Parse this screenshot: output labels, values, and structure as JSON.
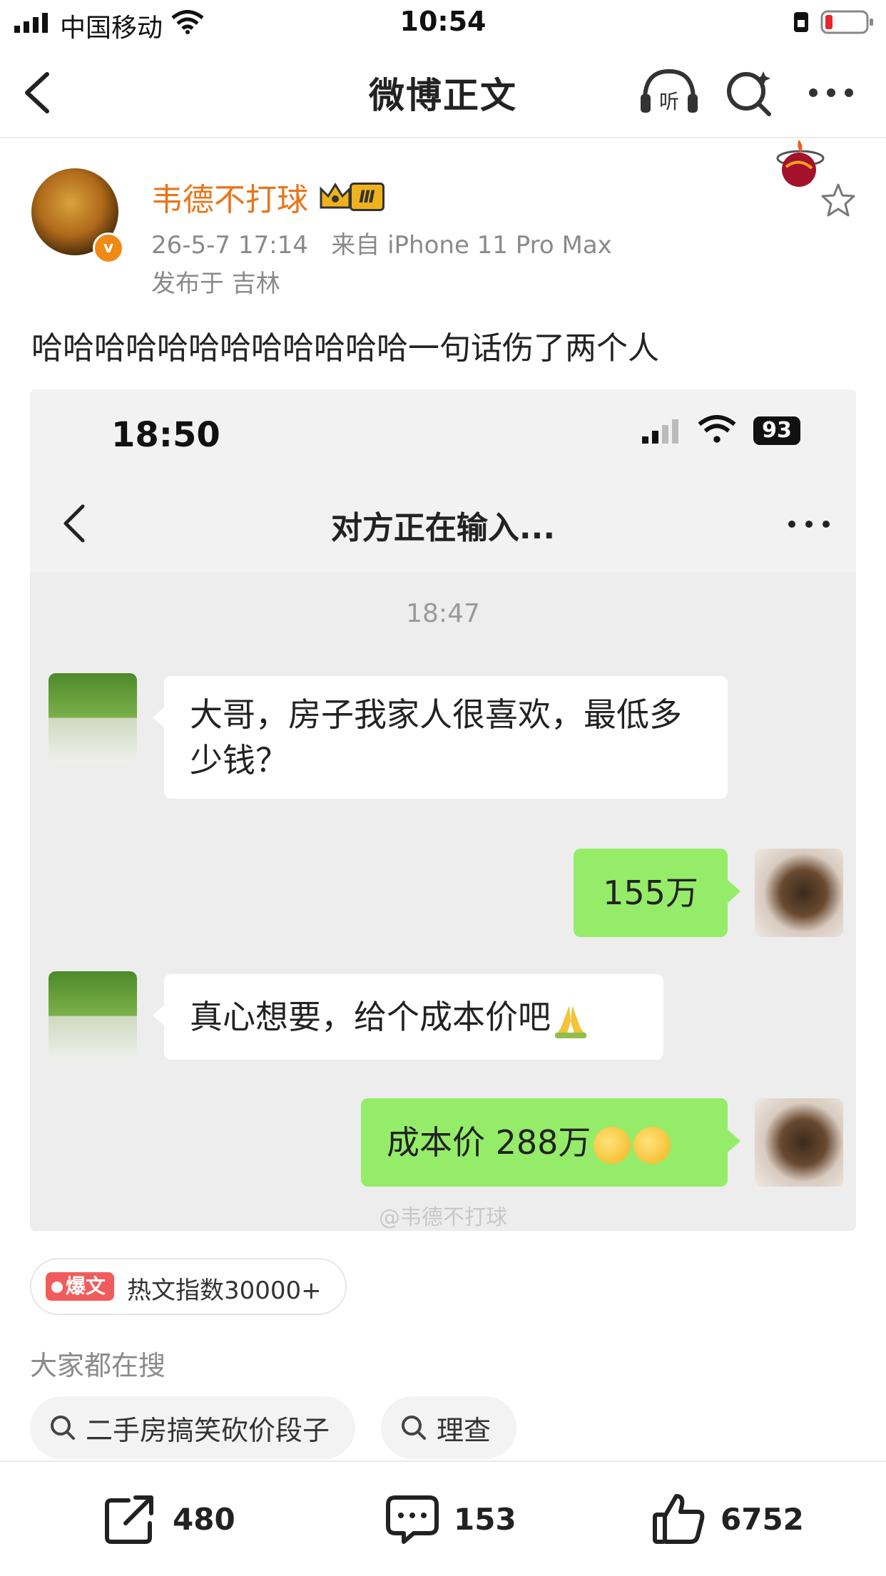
{
  "status_bar": {
    "carrier": "中国移动",
    "time": "10:54"
  },
  "nav": {
    "title": "微博正文"
  },
  "author": {
    "name": "韦德不打球",
    "rank_badge": "Ⅲ"
  },
  "post": {
    "date": "26-5-7 17:14",
    "source": "来自 iPhone 11 Pro Max",
    "location": "发布于 吉林",
    "text": "哈哈哈哈哈哈哈哈哈哈哈哈一句话伤了两个人"
  },
  "screenshot": {
    "time": "18:50",
    "battery": "93",
    "chat_title": "对方正在输入...",
    "timestamp": "18:47",
    "messages": [
      {
        "side": "left",
        "text": "大哥，房子我家人很喜欢，最低多少钱？"
      },
      {
        "side": "right",
        "text": "155万"
      },
      {
        "side": "left",
        "text": "真心想要，给个成本价吧"
      },
      {
        "side": "right",
        "text": "成本价 288万"
      }
    ],
    "watermark": "@韦德不打球"
  },
  "hot": {
    "tag": "爆文",
    "text": "热文指数30000+"
  },
  "search": {
    "heading": "大家都在搜",
    "chips": [
      "二手房搞笑砍价段子",
      "理查"
    ]
  },
  "actions": {
    "share": "480",
    "comment": "153",
    "like": "6752"
  },
  "colors": {
    "author_orange": "#e8751a",
    "chat_green": "#95ec69",
    "hot_red": "#f25b5b"
  }
}
